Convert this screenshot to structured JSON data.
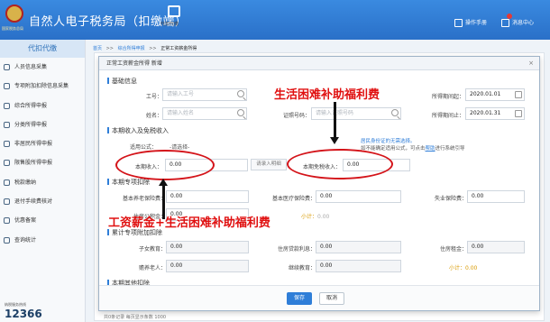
{
  "app": {
    "title": "自然人电子税务局（扣缴端）",
    "emblem_text": "国家税务总局",
    "toolbar_center": "代扣代缴",
    "help_label": "操作手册",
    "messages_label": "消息中心"
  },
  "sidebar": {
    "heading": "代扣代缴",
    "items": [
      {
        "label": "人员信息采集",
        "icon": "person-icon"
      },
      {
        "label": "专项附加扣除信息采集",
        "icon": "list-icon"
      },
      {
        "label": "综合所得申报",
        "icon": "doc-icon"
      },
      {
        "label": "分类所得申报",
        "icon": "doc-icon"
      },
      {
        "label": "非居民所得申报",
        "icon": "person-icon"
      },
      {
        "label": "限售股所得申报",
        "icon": "stock-icon"
      },
      {
        "label": "税款缴纳",
        "icon": "money-icon"
      },
      {
        "label": "退付手续费核对",
        "icon": "check-icon"
      },
      {
        "label": "优惠备案",
        "icon": "gift-icon"
      },
      {
        "label": "查询统计",
        "icon": "chart-icon"
      }
    ],
    "footer_small": "纳税服务热线",
    "footer_big": "12366"
  },
  "breadcrumb": [
    "首页",
    ">>",
    "综合所得申报",
    ">>",
    "正常工资薪金所得"
  ],
  "modal": {
    "title": "正常工资薪金所得 新增",
    "close": "×",
    "sec_basic": "基础信息",
    "work_id_label": "工号：",
    "work_id_placeholder": "请输入工号",
    "name_label": "姓名：",
    "name_placeholder": "请输入姓名",
    "cert_no_label": "证照号码：",
    "cert_no_placeholder": "请输入证照号码",
    "period_start_label": "所得期间起：",
    "period_start": "2020.01.01",
    "period_end_label": "所得期间止：",
    "period_end": "2020.01.31",
    "sec_income": "本期收入及免税收入",
    "formula_label": "适用公式：",
    "formula_value": "-请选择-",
    "income_label": "本期收入：",
    "income_value": "0.00",
    "input_btn": "请录入明细",
    "exempt_label": "本期免税收入：",
    "exempt_value": "0.00",
    "hint1": "居民身份证的无需选择。",
    "hint2_pre": "如不能确定适用公式，可点击",
    "hint2_link": "帮助",
    "hint2_post": "进行系统引导",
    "sec_special": "本期专项扣除",
    "pension_label": "基本养老保险费：",
    "pension_value": "0.00",
    "medical_label": "基本医疗保险费：",
    "medical_value": "0.00",
    "unemploy_label": "失业保险费：",
    "unemploy_value": "0.00",
    "housing_label": "住房公积金：",
    "housing_value": "0.00",
    "subtotal_label": "小计：",
    "subtotal_value": "0.00",
    "sec_cumulative": "累计专项附加扣除",
    "child_edu_label": "子女教育：",
    "child_edu_value": "0.00",
    "mortgage_label": "住房贷款利息：",
    "mortgage_value": "0.00",
    "rent_label": "住房租金：",
    "rent_value": "0.00",
    "elder_label": "赡养老人：",
    "elder_value": "0.00",
    "cont_edu_label": "继续教育：",
    "cont_edu_value": "0.00",
    "subtotal2_label": "小计：",
    "subtotal2_value": "0.00",
    "sec_other": "本期其他扣除",
    "save": "保存",
    "cancel": "取消"
  },
  "bg_footer": "共0条记录  每页显示条数  1000",
  "annotations": {
    "top_text": "生活困难补助福利费",
    "bottom_text": "工资薪金+生活困难补助福利费",
    "color": "#e01010"
  }
}
